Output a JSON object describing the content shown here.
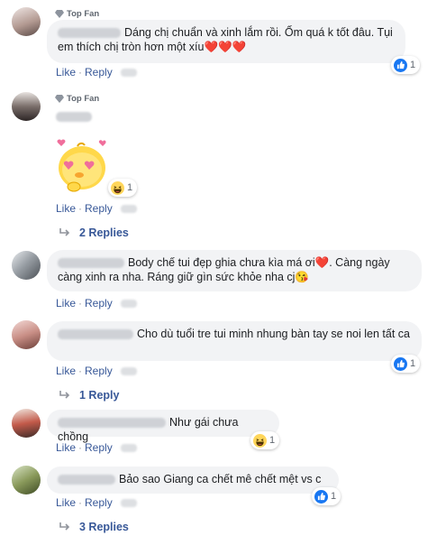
{
  "comments": [
    {
      "badge": "Top Fan",
      "text": "Dáng chị chuẩn và xinh lắm rồi. Ốm quá k tốt đâu. Tụi em thích chị tròn hơn một xíu",
      "hearts": "❤️❤️❤️",
      "like": "Like",
      "reply": "Reply",
      "reaction": {
        "type": "like",
        "count": "1"
      }
    },
    {
      "badge": "Top Fan",
      "sticker": "sticker-chick-hearts",
      "like": "Like",
      "reply": "Reply",
      "reaction": {
        "type": "haha",
        "count": "1"
      },
      "replies": "2 Replies"
    },
    {
      "text": "Body chế tui đẹp ghia chưa kìa má ơi",
      "heart": "❤️",
      "text2": ". Càng ngày càng xinh ra nha. Ráng giữ gìn sức khỏe nha cj",
      "emoji": "😘",
      "like": "Like",
      "reply": "Reply"
    },
    {
      "text": "Cho dù tuổi tre tui minh nhung bàn tay se noi len tất ca",
      "like": "Like",
      "reply": "Reply",
      "reaction": {
        "type": "like",
        "count": "1"
      },
      "replies": "1 Reply"
    },
    {
      "text": "Như gái chưa chồng",
      "like": "Like",
      "reply": "Reply",
      "reaction": {
        "type": "haha",
        "count": "1"
      }
    },
    {
      "text": "Bảo sao Giang ca chết mê chết mệt vs c",
      "like": "Like",
      "reply": "Reply",
      "reaction": {
        "type": "like",
        "count": "1"
      },
      "replies": "3 Replies"
    }
  ],
  "colors": {
    "link": "#385898",
    "bubble": "#f2f3f5",
    "like": "#1877f2",
    "heart": "#e0245e"
  }
}
